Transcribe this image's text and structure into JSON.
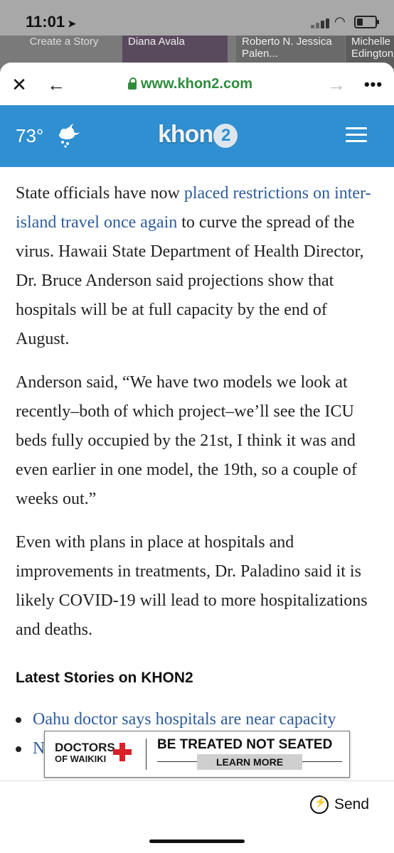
{
  "status_bar": {
    "time": "11:01",
    "location_arrow": "location-arrow-icon"
  },
  "background_stories": [
    "Create a Story",
    "Diana Avala",
    "Roberto N. Jessica Palen...",
    "Michelle Edington"
  ],
  "browser": {
    "url": "www.khon2.com"
  },
  "site_header": {
    "temperature": "73°",
    "logo": "khon",
    "logo_badge": "2",
    "weather_icon": "partly-cloudy-rain-icon"
  },
  "article": {
    "p1_text_a": "State officials have now ",
    "p1_link": "placed restrictions on inter-island travel once again",
    "p1_text_b": " to curve the spread of the virus. Hawaii State Department of Health Director, Dr. Bruce Anderson said projections show that hospitals will be at full capacity by the end of August.",
    "p2": "Anderson said, “We have two models we look at recently–both of which project–we’ll see the ICU beds fully occupied by the 21st, I think it was and even earlier in one model, the 19th, so a couple of weeks out.”",
    "p3": "Even with plans in place at hospitals and improvements in treatments, Dr. Paladino said it is likely COVID-19 will lead to more hospitalizations and deaths.",
    "latest_heading": "Latest Stories on KHON2",
    "latest_items": [
      "Oahu doctor says hospitals are near capacity",
      "N"
    ]
  },
  "ad": {
    "brand_top": "DOCTORS",
    "brand_bottom": "OF WAIKIKI",
    "headline": "BE TREATED NOT SEATED",
    "button": "LEARN MORE"
  },
  "bottom_bar": {
    "send_label": "Send"
  },
  "colors": {
    "header_blue": "#2f8fd0",
    "link_blue": "#2e5c9c",
    "url_green": "#2e8b3c",
    "ad_cross_red": "#d92027"
  }
}
